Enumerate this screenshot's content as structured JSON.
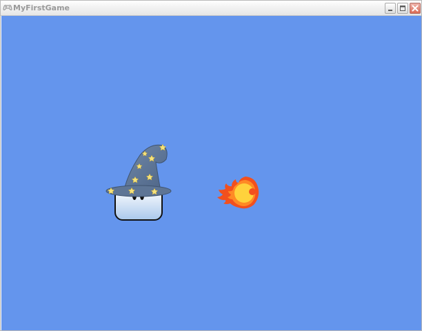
{
  "window": {
    "title": "MyFirstGame",
    "app_icon": "gamepad-icon",
    "controls": {
      "minimize": "minimize-icon",
      "maximize": "maximize-icon",
      "close": "close-icon"
    }
  },
  "game": {
    "background_color": "#6495ed",
    "sprites": [
      {
        "name": "wizard",
        "description_icon": "wizard-sprite"
      },
      {
        "name": "fireball",
        "description_icon": "fireball-sprite"
      }
    ]
  },
  "colors": {
    "hat": "#5e7595",
    "hat_dark": "#3f5470",
    "star": "#f6e27a",
    "face_top": "#ffffff",
    "face_bottom": "#aac8ec",
    "fire_outer": "#f2501e",
    "fire_core": "#ffd23c"
  }
}
